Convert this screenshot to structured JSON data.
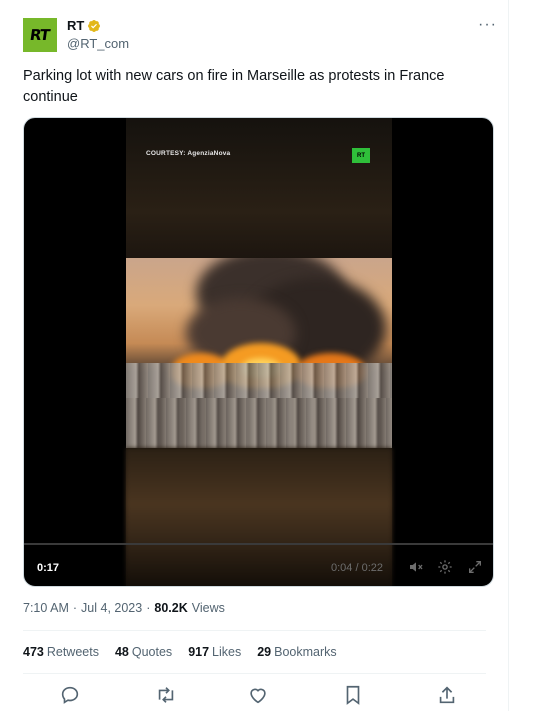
{
  "author": {
    "avatar_text": "RT",
    "display_name": "RT",
    "handle": "@RT_com",
    "verified": true,
    "verified_color": "#e2b719"
  },
  "more_label": "···",
  "tweet_text": "Parking lot with new cars on fire in Marseille as protests in France continue",
  "media": {
    "courtesy_text": "COURTESY: AgenziaNova",
    "watermark": "RT",
    "duration": "0:17",
    "time_readout": "0:04 / 0:22",
    "progress": 0.0
  },
  "meta": {
    "time": "7:10 AM",
    "separator": "·",
    "date": "Jul 4, 2023",
    "views_count": "80.2K",
    "views_label": "Views"
  },
  "stats": [
    {
      "count": "473",
      "label": "Retweets"
    },
    {
      "count": "48",
      "label": "Quotes"
    },
    {
      "count": "917",
      "label": "Likes"
    },
    {
      "count": "29",
      "label": "Bookmarks"
    }
  ],
  "actions": [
    "reply-icon",
    "retweet-icon",
    "like-icon",
    "bookmark-icon",
    "share-icon"
  ],
  "colors": {
    "accent": "#1d9bf0",
    "text_primary": "#0f1419",
    "text_secondary": "#536471",
    "rt_brand": "#77b82a"
  }
}
